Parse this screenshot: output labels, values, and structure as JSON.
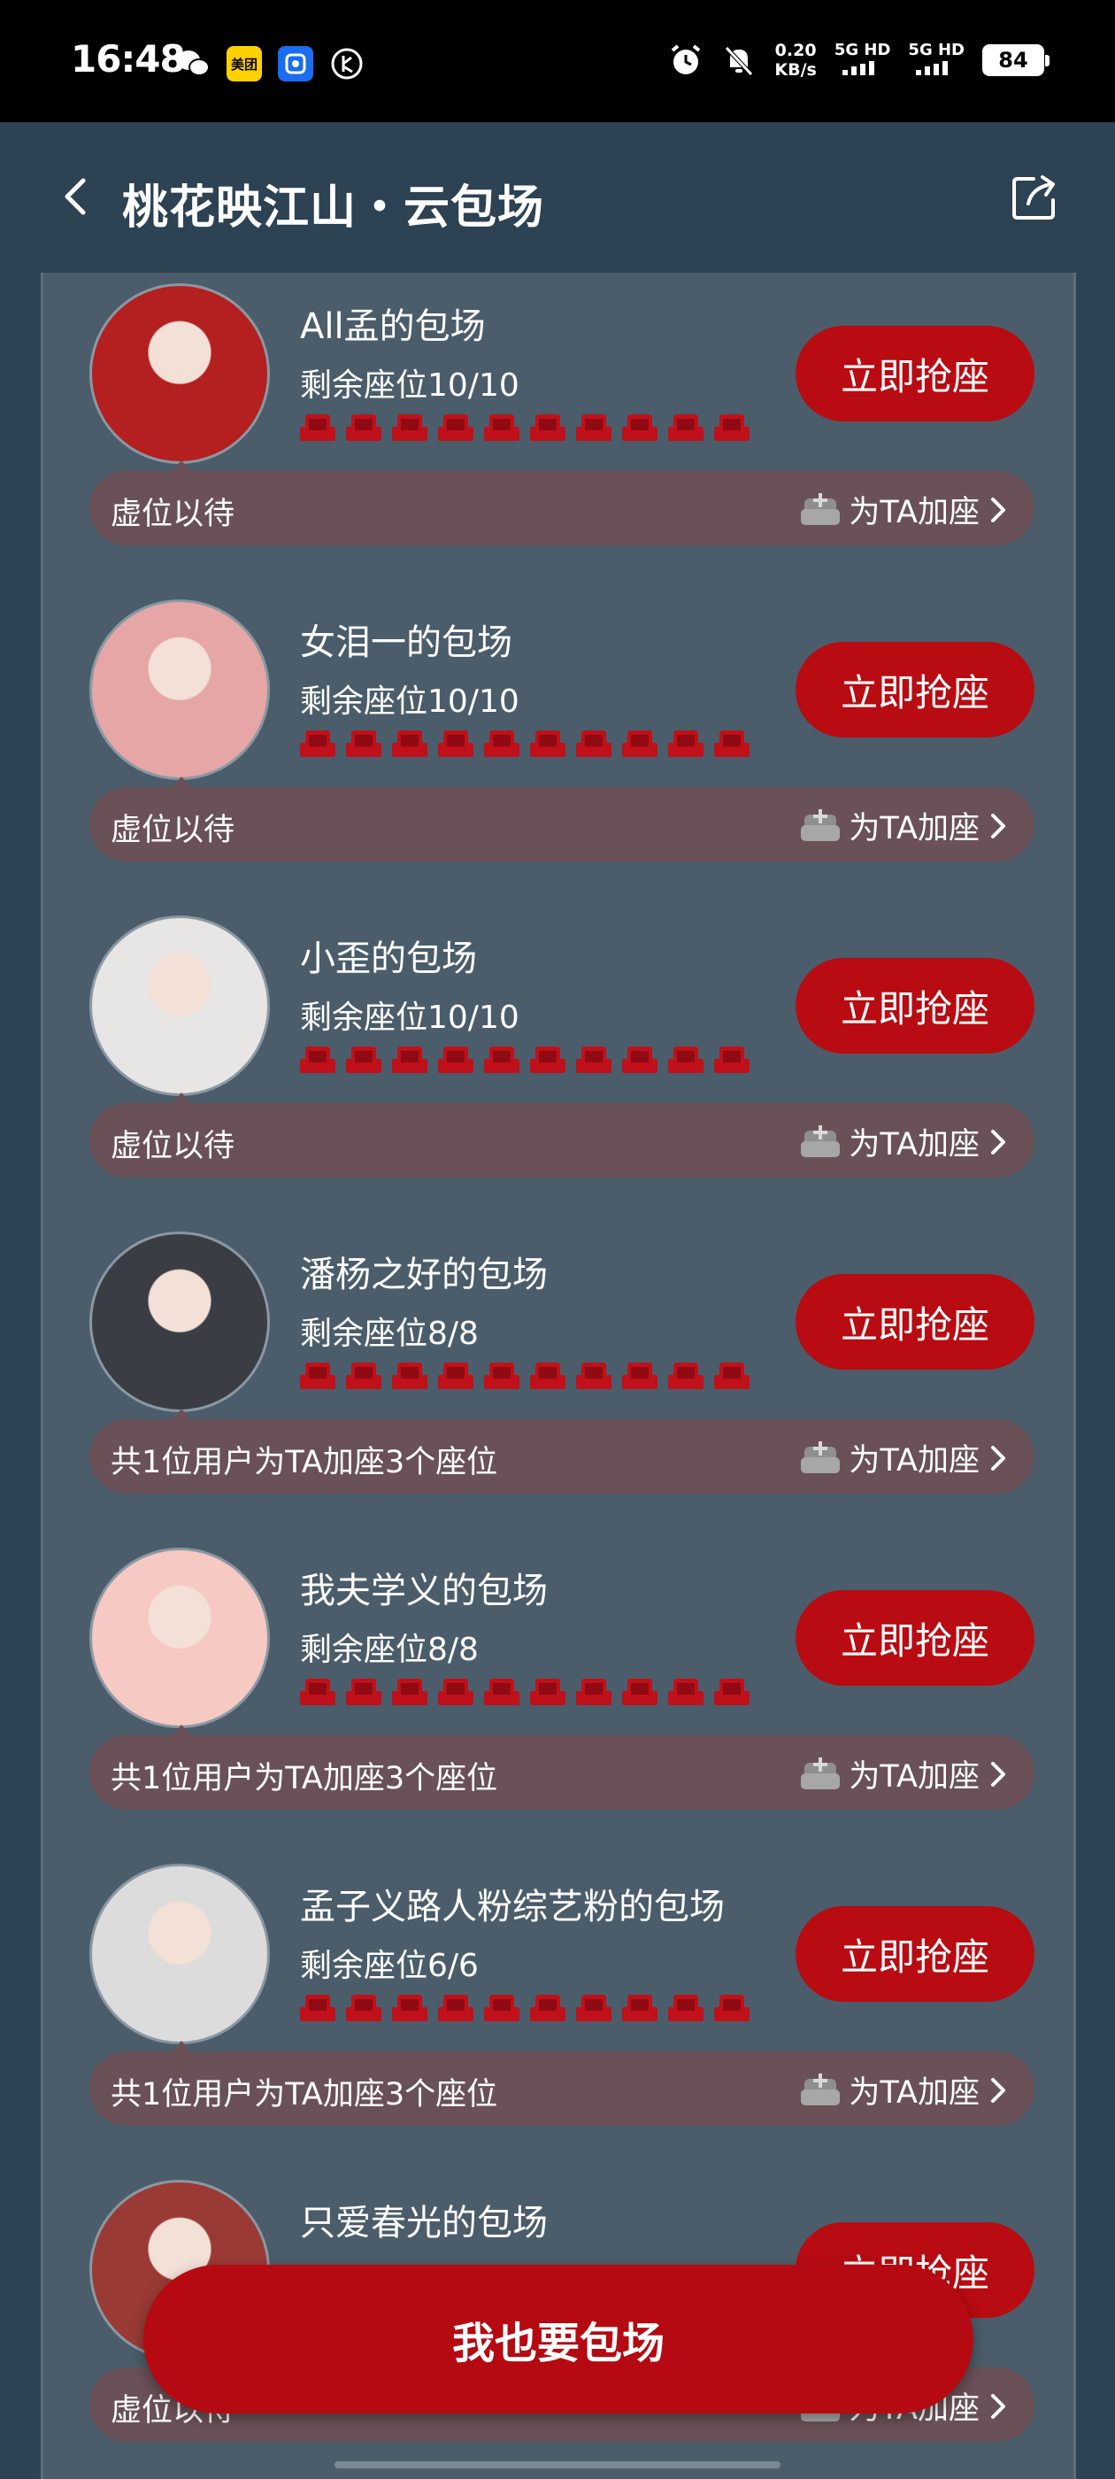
{
  "status_bar": {
    "time": "16:48",
    "speed_value": "0.20",
    "speed_unit": "KB/s",
    "net1": "5G HD",
    "net2": "5G HD",
    "battery": "84",
    "apps": [
      {
        "icon": "wechat-icon",
        "label": ""
      },
      {
        "icon": "meituan-icon",
        "label": "美团"
      },
      {
        "icon": "app-blue-icon",
        "label": ""
      },
      {
        "icon": "app-circle-icon",
        "label": ""
      }
    ]
  },
  "header": {
    "title": "桃花映江山・云包场",
    "back_icon": "chevron-left-icon",
    "share_icon": "share-icon"
  },
  "rooms": [
    {
      "name": "All孟的包场",
      "remaining": "剩余座位10/10",
      "seats": 10,
      "button": "立即抢座",
      "bar_text": "虚位以待",
      "add_label": "为TA加座",
      "avatar_color": "#b3201f"
    },
    {
      "name": "女泪一的包场",
      "remaining": "剩余座位10/10",
      "seats": 10,
      "button": "立即抢座",
      "bar_text": "虚位以待",
      "add_label": "为TA加座",
      "avatar_color": "#e6a6a6"
    },
    {
      "name": "小歪的包场",
      "remaining": "剩余座位10/10",
      "seats": 10,
      "button": "立即抢座",
      "bar_text": "虚位以待",
      "add_label": "为TA加座",
      "avatar_color": "#e8e6e4"
    },
    {
      "name": "潘杨之好的包场",
      "remaining": "剩余座位8/8",
      "seats": 10,
      "button": "立即抢座",
      "bar_text": "共1位用户为TA加座3个座位",
      "add_label": "为TA加座",
      "avatar_color": "#3a3d44"
    },
    {
      "name": "我夫学义的包场",
      "remaining": "剩余座位8/8",
      "seats": 10,
      "button": "立即抢座",
      "bar_text": "共1位用户为TA加座3个座位",
      "add_label": "为TA加座",
      "avatar_color": "#f6c9c3"
    },
    {
      "name": "孟子义路人粉综艺粉的包场",
      "remaining": "剩余座位6/6",
      "seats": 10,
      "button": "立即抢座",
      "bar_text": "共1位用户为TA加座3个座位",
      "add_label": "为TA加座",
      "avatar_color": "#dcdcdc"
    },
    {
      "name": "只爱春光的包场",
      "remaining": "",
      "seats": 0,
      "button": "立即抢座",
      "bar_text": "虚位以待",
      "add_label": "为TA加座",
      "avatar_color": "#9a3a35"
    }
  ],
  "cta": {
    "label": "我也要包场"
  },
  "colors": {
    "background": "#2d4252",
    "panel": "#4b5d6a",
    "button_red": "#b80b12",
    "seat_red": "#c0101a",
    "bar_bg": "#6a5157"
  }
}
